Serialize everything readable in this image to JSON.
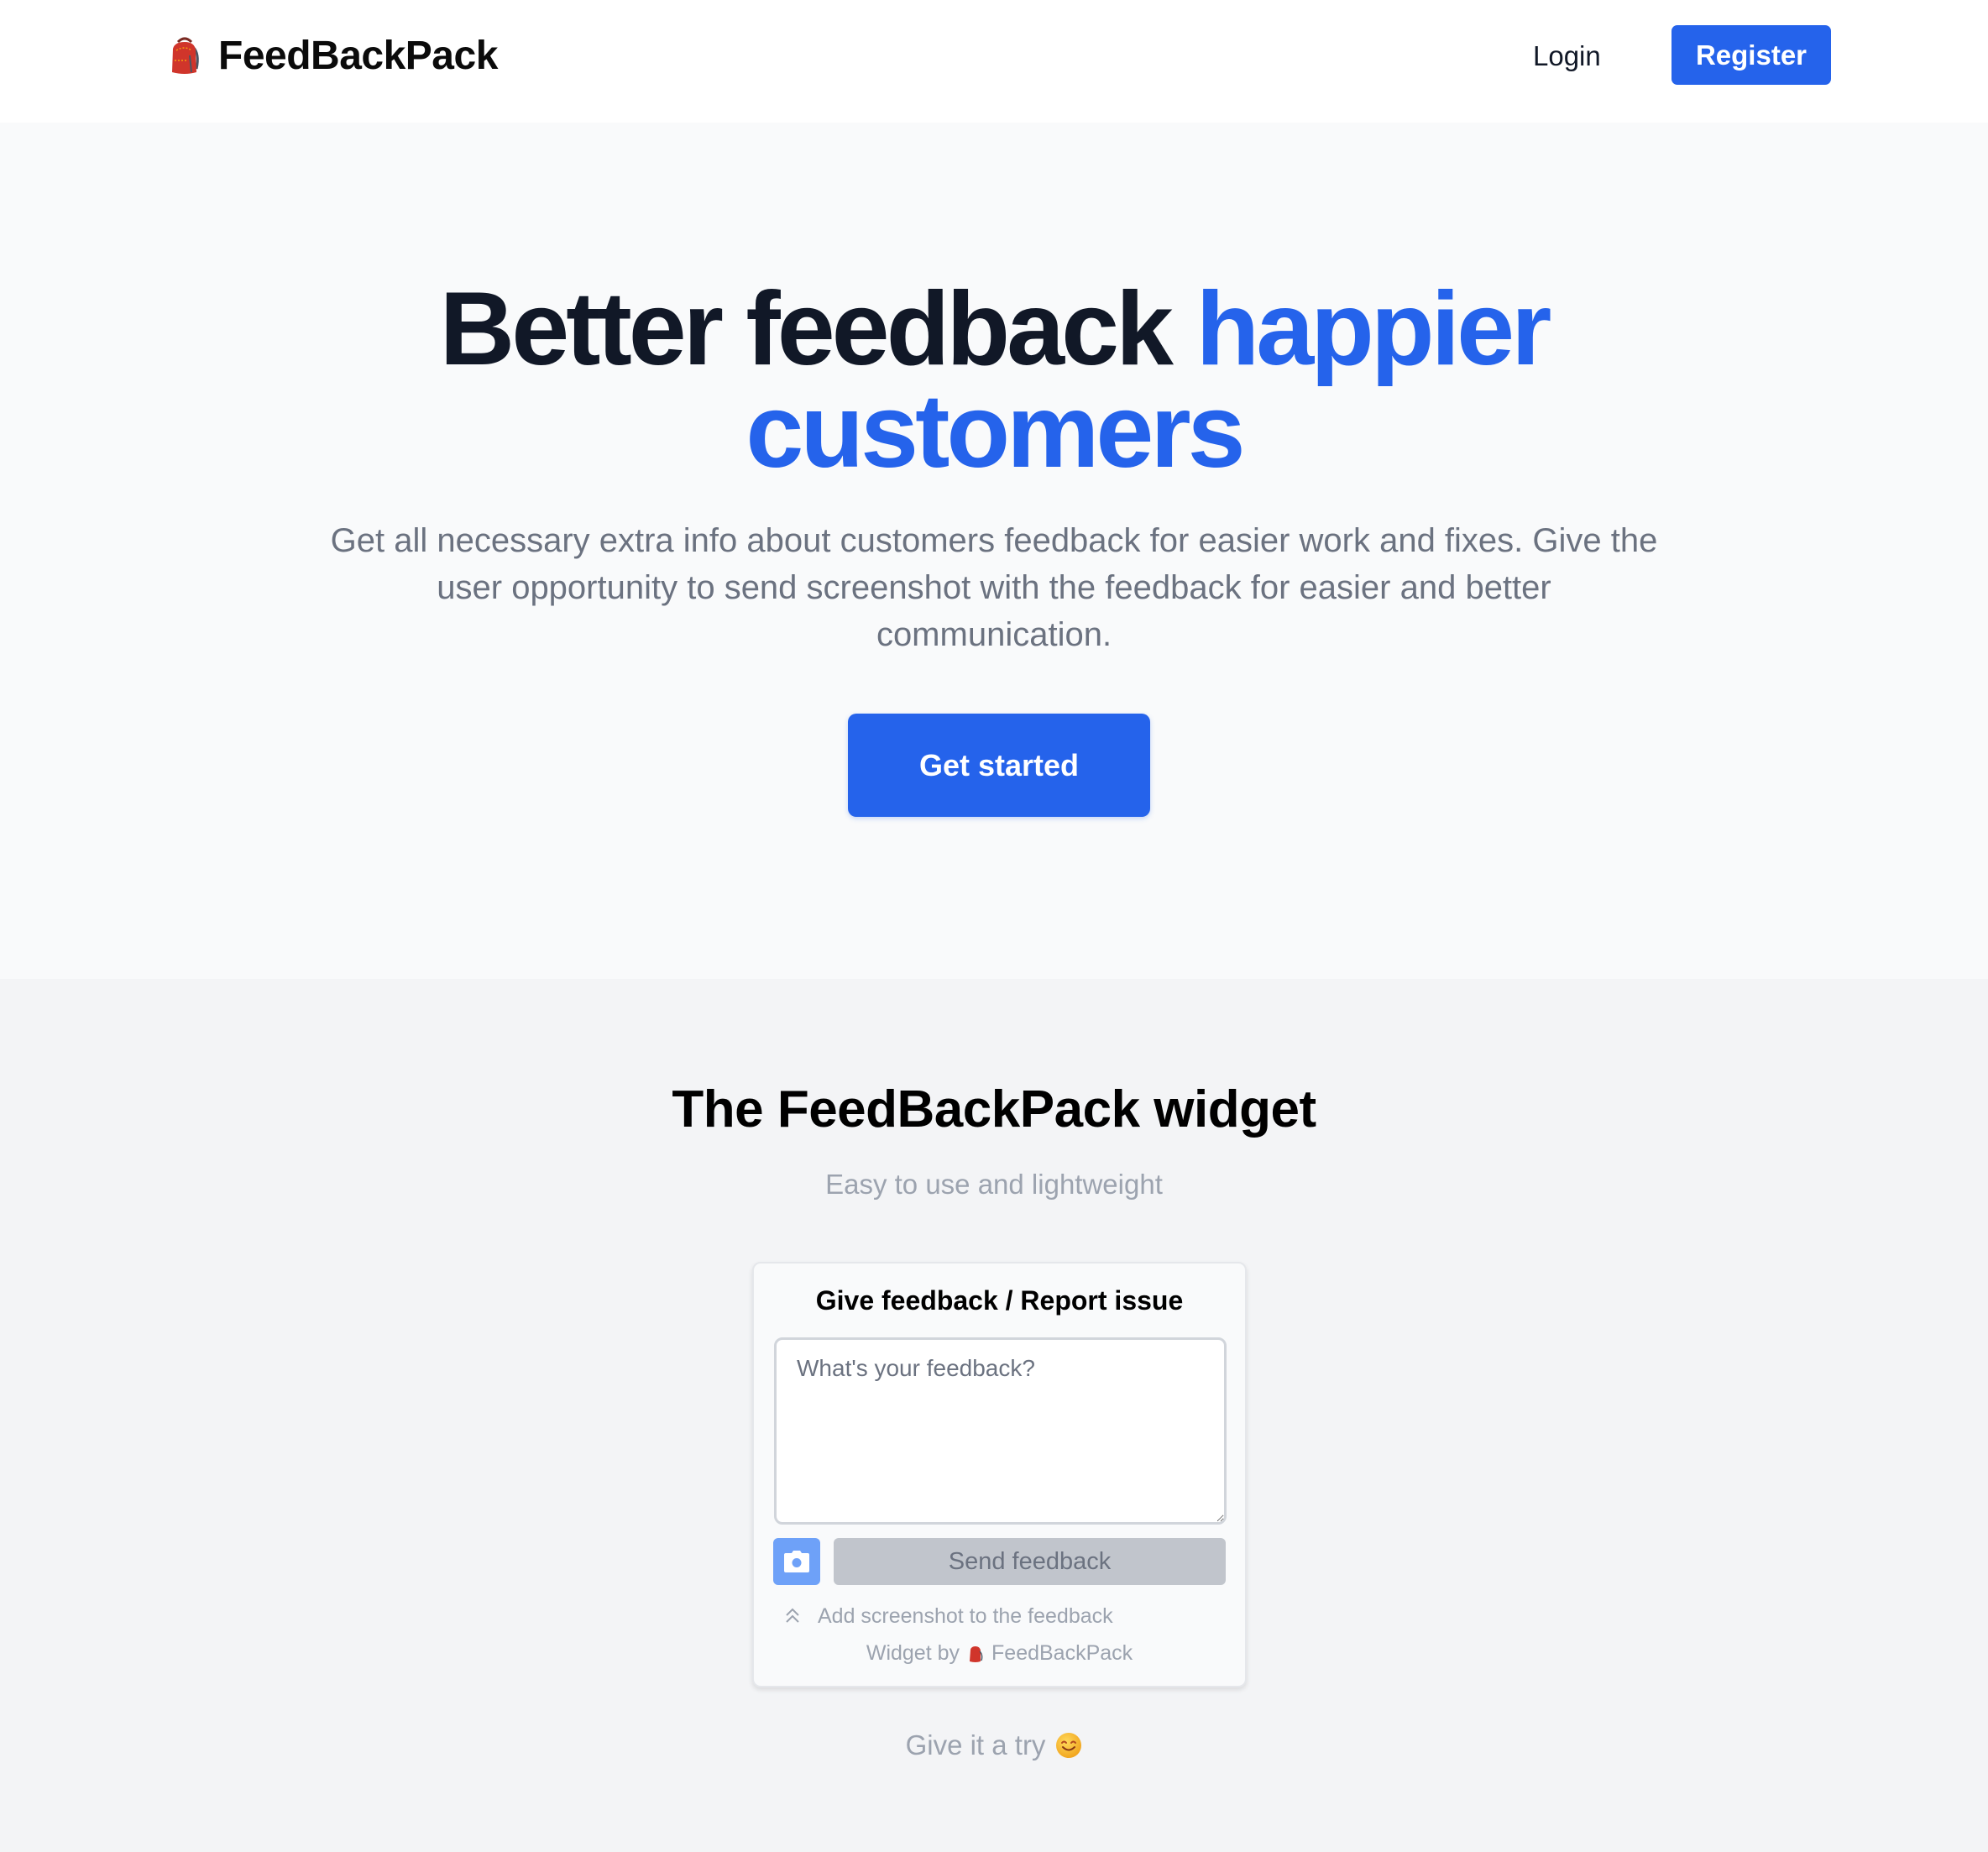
{
  "header": {
    "brand_name": "FeedBackPack",
    "brand_icon": "backpack-icon",
    "login_label": "Login",
    "register_label": "Register"
  },
  "hero": {
    "title_part1": "Better feedback ",
    "title_accent": "happier customers",
    "description": "Get all necessary extra info about customers feedback for easier work and fixes. Give the user opportunity to send screenshot with the feedback for easier and better communication.",
    "cta_label": "Get started"
  },
  "widget_section": {
    "title": "The FeedBackPack widget",
    "subtitle": "Easy to use and lightweight",
    "widget": {
      "title": "Give feedback / Report issue",
      "textarea_value": "",
      "textarea_placeholder": "What's your feedback?",
      "camera_icon": "camera-icon",
      "send_label": "Send feedback",
      "add_screenshot_label": "Add screenshot to the feedback",
      "add_screenshot_icon": "chevrons-up-icon",
      "credit_prefix": "Widget by",
      "credit_brand": "FeedBackPack"
    },
    "try_text": "Give it a try",
    "try_emoji_icon": "smiling-face-icon"
  },
  "colors": {
    "accent": "#2563eb",
    "camera_button": "#6ea1f8",
    "send_disabled": "#c1c5cc",
    "heading": "#111827",
    "muted": "#6b7280",
    "subtle": "#9ca3af",
    "hero_bg": "#f9fafb",
    "section_bg": "#f3f4f6"
  }
}
